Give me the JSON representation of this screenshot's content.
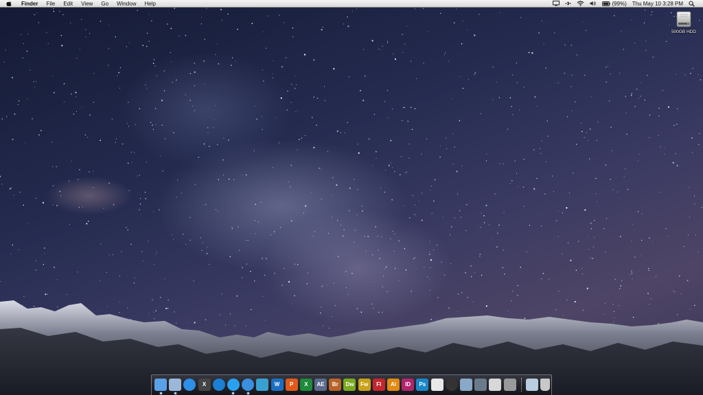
{
  "menubar": {
    "app_name": "Finder",
    "items": [
      "File",
      "Edit",
      "View",
      "Go",
      "Window",
      "Help"
    ],
    "status": {
      "battery": "(99%)",
      "datetime": "Thu May 10  3:28 PM",
      "icons": [
        "display-icon",
        "bluetooth-icon",
        "wifi-icon",
        "volume-icon",
        "battery-icon",
        "spotlight-icon"
      ]
    }
  },
  "desktop": {
    "icons": [
      {
        "name": "hard-drive-icon",
        "label": "500GB HDD"
      }
    ]
  },
  "dock": {
    "apps": [
      {
        "name": "finder",
        "label": "",
        "bg": "#5aa0e6",
        "running": true
      },
      {
        "name": "mail",
        "label": "",
        "bg": "#9bb8d8",
        "running": true
      },
      {
        "name": "safari",
        "label": "",
        "bg": "#2d8fe6",
        "running": false
      },
      {
        "name": "mac-os-x",
        "label": "X",
        "bg": "#444444",
        "running": false
      },
      {
        "name": "app-store",
        "label": "",
        "bg": "#1b7fd4",
        "running": false
      },
      {
        "name": "app-store-2",
        "label": "",
        "bg": "#2aa0f0",
        "running": true
      },
      {
        "name": "itunes",
        "label": "",
        "bg": "#3a8fe0",
        "running": true
      },
      {
        "name": "textwrangler",
        "label": "",
        "bg": "#3aa0d0",
        "running": false
      },
      {
        "name": "word",
        "label": "W",
        "bg": "#1a6fc0",
        "running": false
      },
      {
        "name": "powerpoint",
        "label": "P",
        "bg": "#e05a1c",
        "running": false
      },
      {
        "name": "excel",
        "label": "X",
        "bg": "#1e8a3a",
        "running": false
      },
      {
        "name": "after-effects",
        "label": "AE",
        "bg": "#5b6a8a",
        "running": false
      },
      {
        "name": "bridge",
        "label": "Br",
        "bg": "#b8632a",
        "running": false
      },
      {
        "name": "dreamweaver",
        "label": "Dw",
        "bg": "#7aaa1e",
        "running": false
      },
      {
        "name": "fireworks",
        "label": "Fw",
        "bg": "#c9a21a",
        "running": false
      },
      {
        "name": "flash",
        "label": "Fl",
        "bg": "#c4262e",
        "running": false
      },
      {
        "name": "illustrator",
        "label": "Ai",
        "bg": "#e08a14",
        "running": false
      },
      {
        "name": "indesign",
        "label": "ID",
        "bg": "#b0246e",
        "running": false
      },
      {
        "name": "photoshop",
        "label": "Ps",
        "bg": "#1a86c6",
        "running": false
      },
      {
        "name": "acrobat",
        "label": "",
        "bg": "#e8e8e8",
        "running": false
      },
      {
        "name": "aperture",
        "label": "",
        "bg": "#333333",
        "running": false
      },
      {
        "name": "utility",
        "label": "",
        "bg": "#8aa8c8",
        "running": false
      },
      {
        "name": "steam",
        "label": "",
        "bg": "#6a7a8a",
        "running": false
      },
      {
        "name": "pdf-tool",
        "label": "",
        "bg": "#d8d8d8",
        "running": false
      },
      {
        "name": "facetime",
        "label": "",
        "bg": "#9a9a9a",
        "running": false
      }
    ],
    "folders": [
      {
        "name": "downloads-folder",
        "bg": "#b8cde0"
      },
      {
        "name": "trash",
        "bg": "#c8c8c8"
      }
    ]
  }
}
